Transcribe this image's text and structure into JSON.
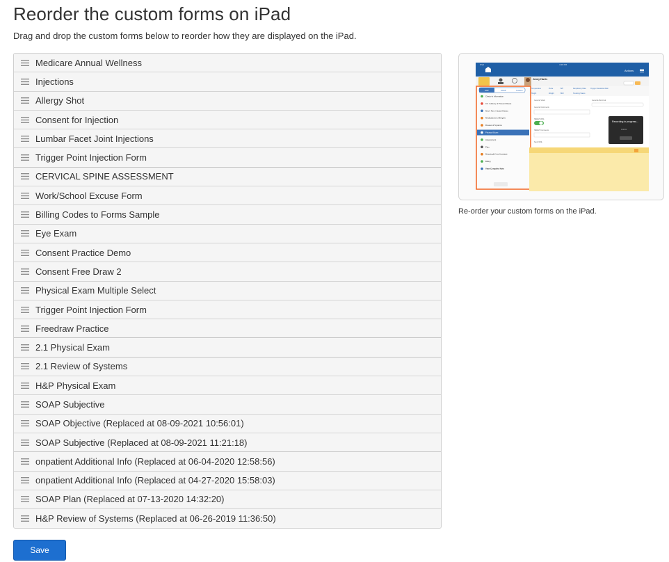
{
  "page": {
    "title": "Reorder the custom forms on iPad",
    "subtitle": "Drag and drop the custom forms below to reorder how they are displayed on the iPad."
  },
  "forms": [
    "Medicare Annual Wellness",
    "Injections",
    "Allergy Shot",
    "Consent for Injection",
    "Lumbar Facet Joint Injections",
    "Trigger Point Injection Form",
    "CERVICAL SPINE ASSESSMENT",
    "Work/School Excuse Form",
    "Billing Codes to Forms Sample",
    "Eye Exam",
    "Consent Practice Demo",
    "Consent Free Draw 2",
    "Physical Exam Multiple Select",
    "Trigger Point Injection Form",
    "Freedraw Practice",
    "2.1 Physical Exam",
    "2.1 Review of Systems",
    "H&P Physical Exam",
    "SOAP Subjective",
    "SOAP Objective (Replaced at 08-09-2021 10:56:01)",
    "SOAP Subjective (Replaced at 08-09-2021 11:21:18)",
    "onpatient Additional Info (Replaced at 06-04-2020 12:58:56)",
    "onpatient Additional Info (Replaced at 04-27-2020 15:58:03)",
    "SOAP Plan (Replaced at 07-13-2020 14:32:20)",
    "H&P Review of Systems (Replaced at 06-26-2019 11:36:50)"
  ],
  "save_label": "Save",
  "preview": {
    "caption": "Re-order your custom forms on the iPad.",
    "tabs": [
      "H&P",
      "SOAP",
      "Custom"
    ],
    "menu": [
      "Check-In Information",
      "CC / History of Present Illness",
      "Med / Fam / Social History",
      "Medications & Allergies",
      "Review of Systems",
      "Physical Exam",
      "Assessment",
      "Plan",
      "Meaningful Use Assistant",
      "Billing",
      "View Complete Note"
    ],
    "recording_text": "Recording in progress...",
    "patient_name": "Jenny Harris",
    "actions_label": "Actions",
    "accent_orange": "#f26522",
    "nav_blue": "#1f5fa6"
  },
  "colors": {
    "save_blue": "#1d6fd0",
    "list_bg": "#f5f5f5",
    "border": "#d4d4d4"
  }
}
